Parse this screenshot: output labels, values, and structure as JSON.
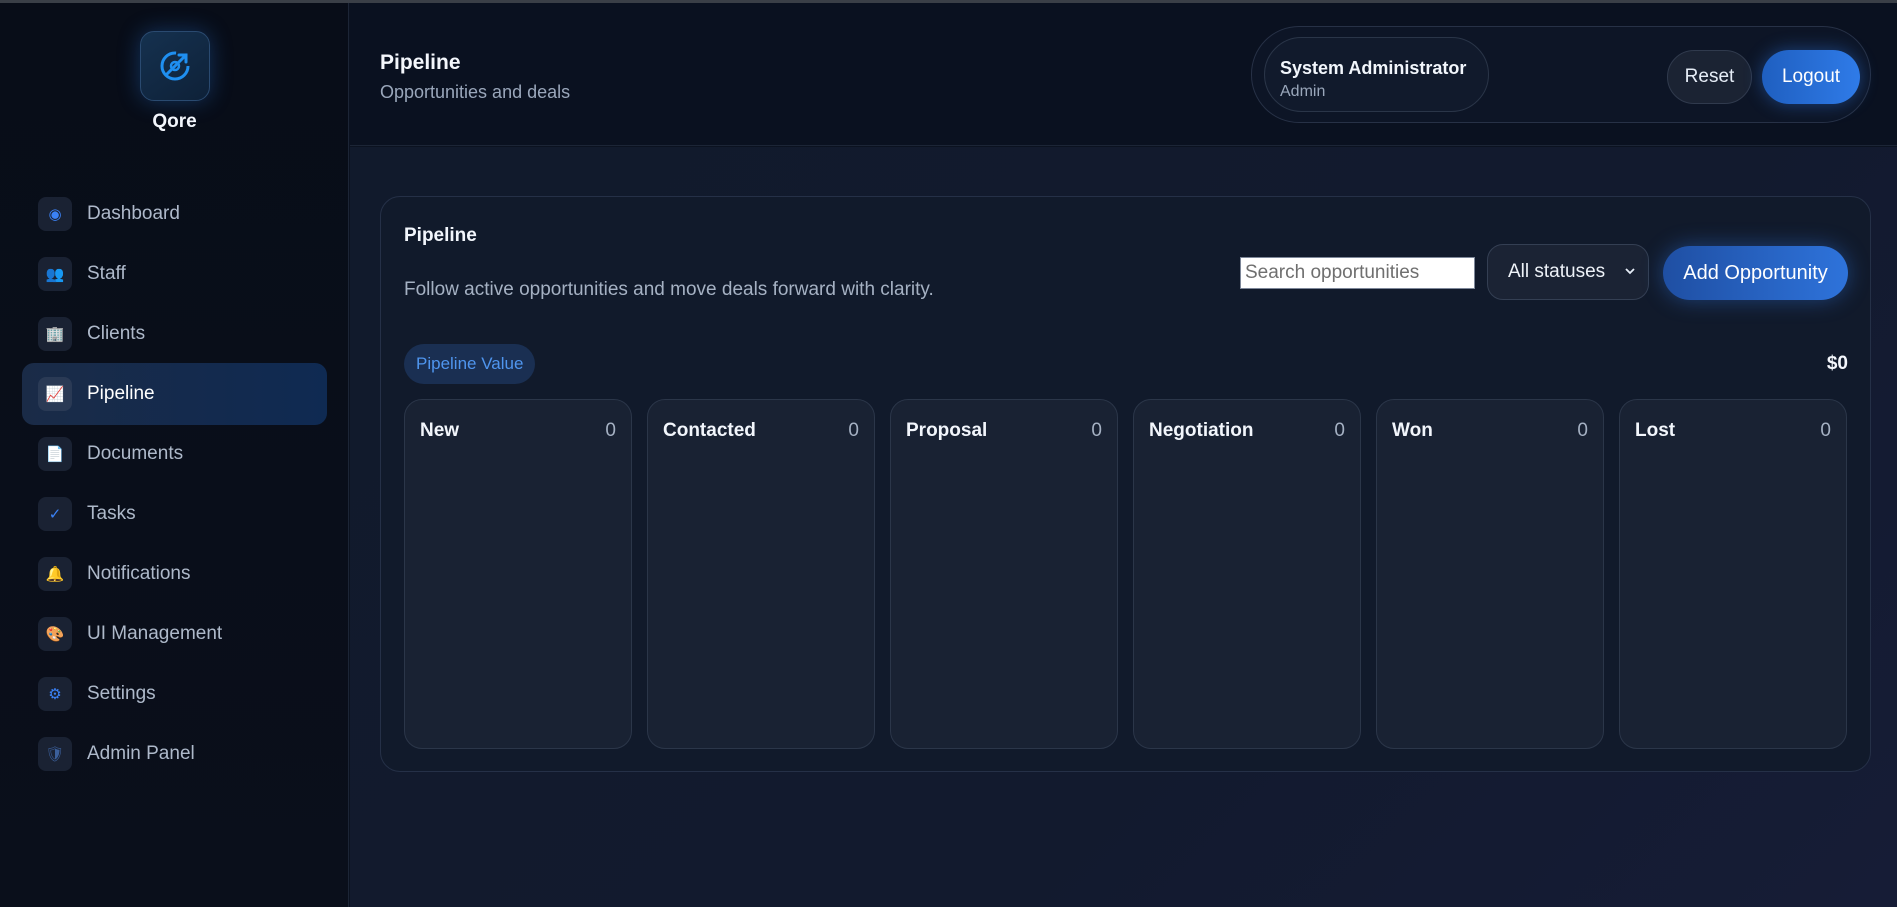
{
  "brand": {
    "name": "Qore",
    "logo_icon": "compass-icon",
    "accent": "#1f8ff0"
  },
  "sidebar": {
    "items": [
      {
        "label": "Dashboard",
        "icon": "radio-dot-icon",
        "glyph": "◉",
        "color": "#3b82f6",
        "active": false
      },
      {
        "label": "Staff",
        "icon": "people-icon",
        "glyph": "👥",
        "color": "#7c6ee6",
        "active": false
      },
      {
        "label": "Clients",
        "icon": "building-icon",
        "glyph": "🏢",
        "color": "#7fa6d8",
        "active": false
      },
      {
        "label": "Pipeline",
        "icon": "chart-increasing-icon",
        "glyph": "📈",
        "color": "#e6edf7",
        "active": true
      },
      {
        "label": "Documents",
        "icon": "document-icon",
        "glyph": "📄",
        "color": "#dfe6f0",
        "active": false
      },
      {
        "label": "Tasks",
        "icon": "checkmark-icon",
        "glyph": "✓",
        "color": "#3b82f6",
        "active": false
      },
      {
        "label": "Notifications",
        "icon": "bell-icon",
        "glyph": "🔔",
        "color": "#f1b53d",
        "active": false
      },
      {
        "label": "UI Management",
        "icon": "palette-icon",
        "glyph": "🎨",
        "color": "#e8a0a0",
        "active": false
      },
      {
        "label": "Settings",
        "icon": "gear-icon",
        "glyph": "⚙",
        "color": "#3b82f6",
        "active": false
      },
      {
        "label": "Admin Panel",
        "icon": "shield-icon",
        "glyph": "🛡",
        "color": "#3b5f9a",
        "active": false
      }
    ]
  },
  "header": {
    "title": "Pipeline",
    "subtitle": "Opportunities and deals",
    "user": {
      "name": "System Administrator",
      "role": "Admin"
    },
    "reset_label": "Reset",
    "logout_label": "Logout"
  },
  "panel": {
    "title": "Pipeline",
    "description": "Follow active opportunities and move deals forward with clarity.",
    "search": {
      "placeholder": "Search opportunities",
      "value": ""
    },
    "status_filter": {
      "selected": "All statuses"
    },
    "add_label": "Add Opportunity",
    "value_label": "Pipeline Value",
    "value_amount": "$0",
    "columns": [
      {
        "name": "New",
        "count": "0"
      },
      {
        "name": "Contacted",
        "count": "0"
      },
      {
        "name": "Proposal",
        "count": "0"
      },
      {
        "name": "Negotiation",
        "count": "0"
      },
      {
        "name": "Won",
        "count": "0"
      },
      {
        "name": "Lost",
        "count": "0"
      }
    ]
  }
}
